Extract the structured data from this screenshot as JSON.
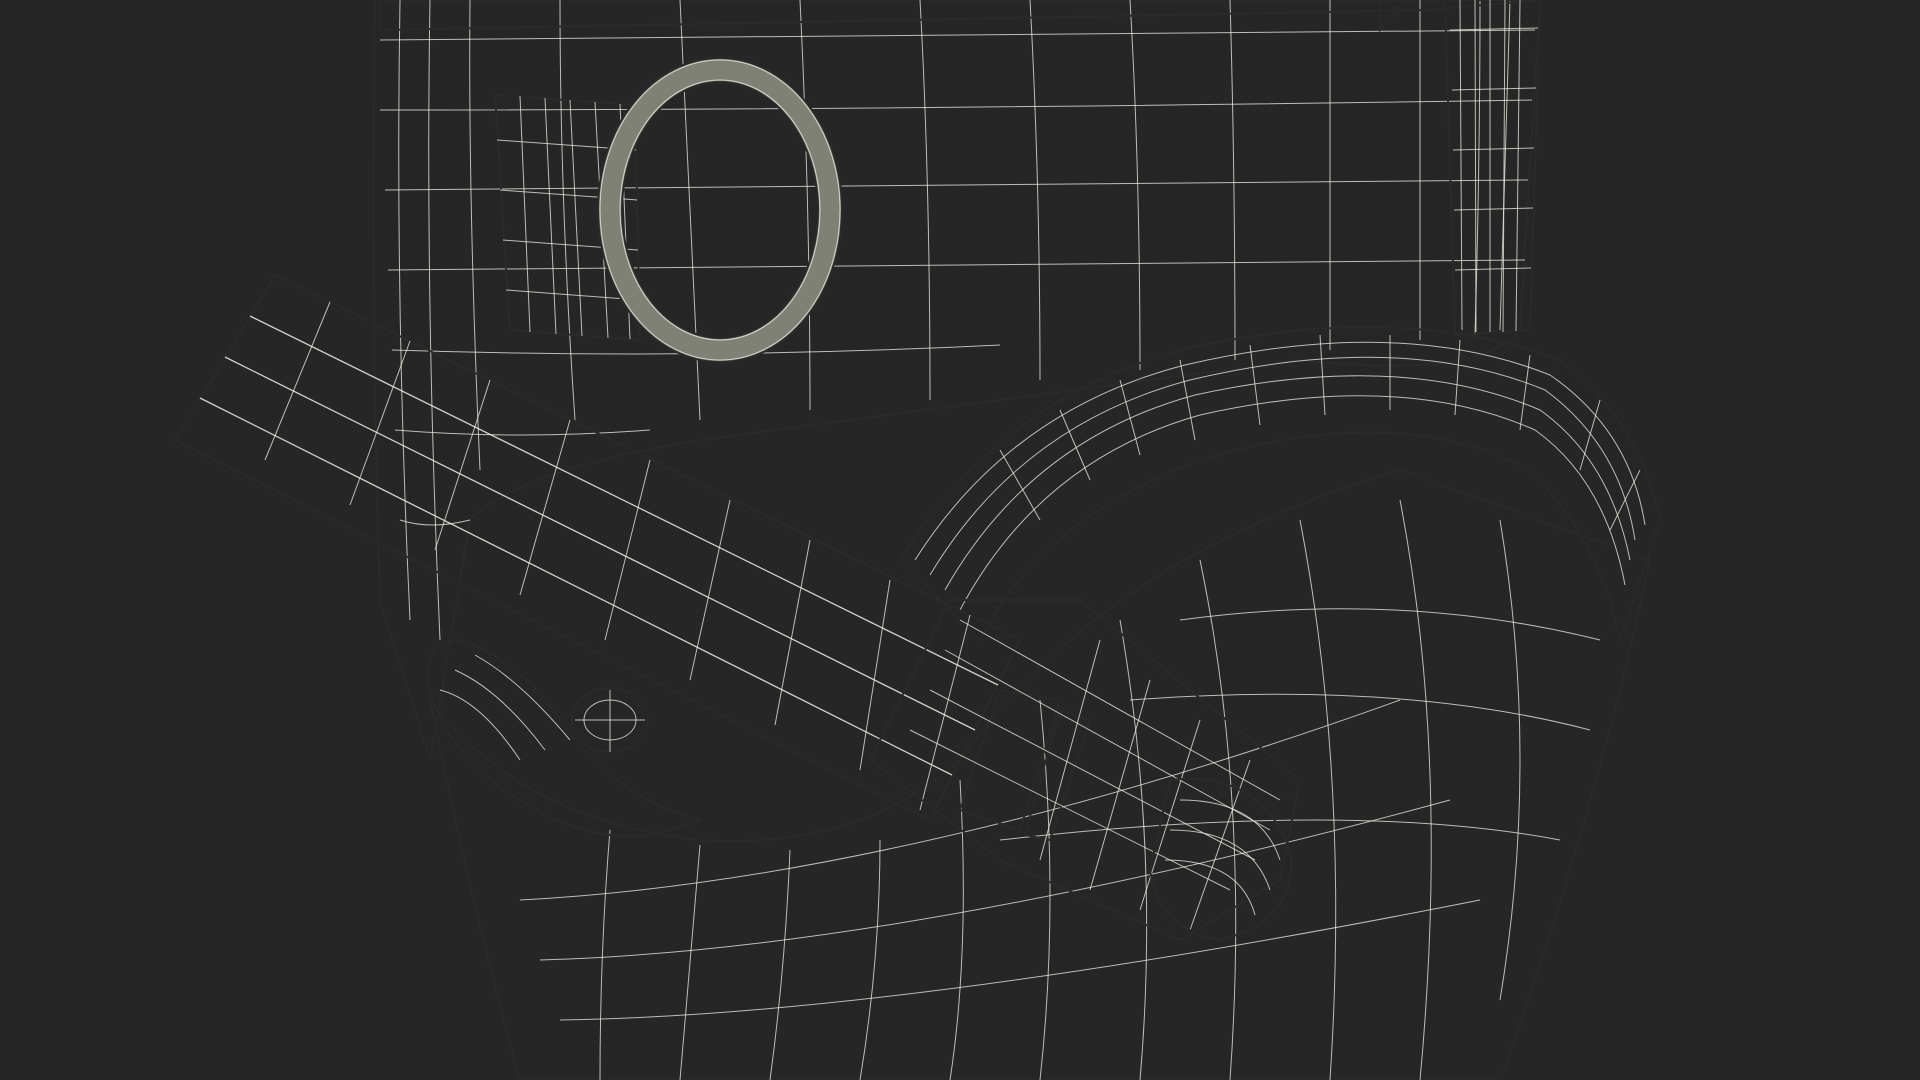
{
  "scene": {
    "subject": "wireframe-3d-model",
    "colors": {
      "background": "#262626",
      "surface_dark": "#5d5e57",
      "surface_mid": "#6f7067",
      "surface_light": "#8a8b80",
      "surface_strap": "#878879",
      "wire": "#f3f0e6"
    }
  }
}
